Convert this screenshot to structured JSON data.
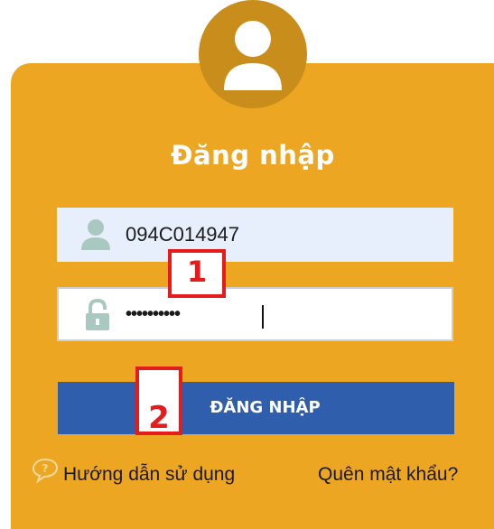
{
  "colors": {
    "card_background": "#eca622",
    "avatar_circle": "#c98d1b",
    "button_background": "#2f5ead",
    "username_field_background": "#e7eefc",
    "annotation_red": "#e41c1c"
  },
  "header": {
    "avatar_icon": "user-avatar-icon",
    "title": "Đăng nhập"
  },
  "form": {
    "username": {
      "icon": "user-icon",
      "value": "094C014947"
    },
    "password": {
      "icon": "lock-icon",
      "value": "••••••••••"
    },
    "submit_label": "ĐĂNG NHẬP"
  },
  "annotations": {
    "step1": "1",
    "step2": "2"
  },
  "footer": {
    "help_icon": "help-bubble-icon",
    "help_label": "Hướng dẫn sử dụng",
    "forgot_label": "Quên mật khẩu?"
  }
}
